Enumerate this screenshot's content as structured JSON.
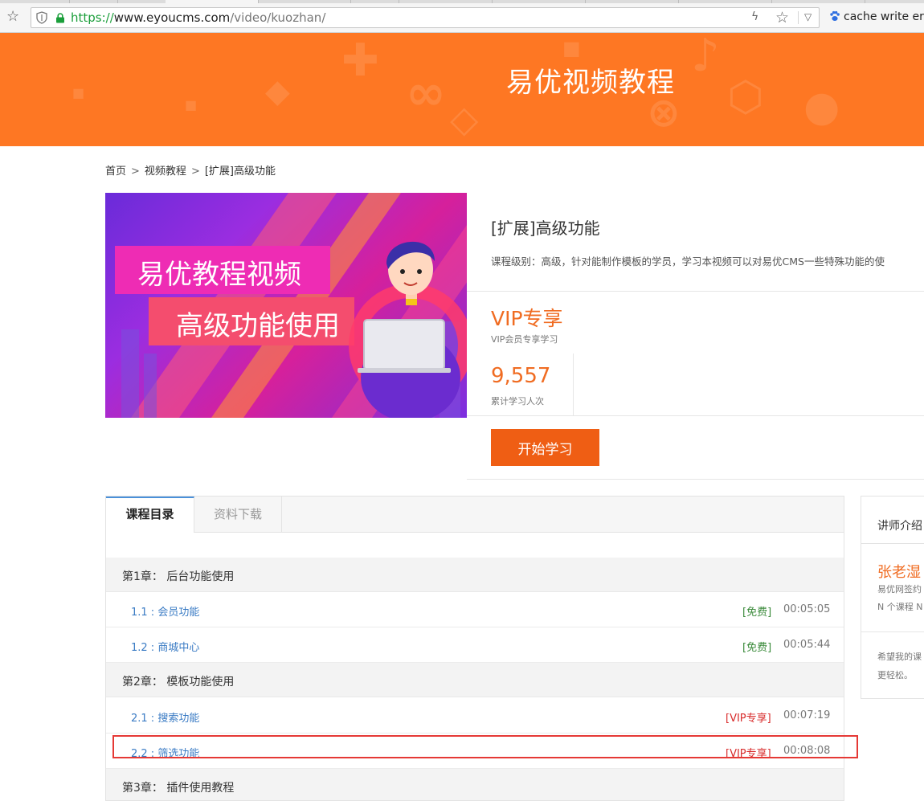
{
  "browser": {
    "url_scheme": "https://",
    "url_host": "www.eyoucms.com",
    "url_path": "/video/kuozhan/",
    "extension_text": "cache write err"
  },
  "banner": {
    "title": "易优视频教程"
  },
  "breadcrumb": {
    "items": [
      "首页",
      "视频教程",
      "[扩展]高级功能"
    ],
    "separator": ">"
  },
  "cover": {
    "line1": "易优教程视频",
    "line2": "高级功能使用"
  },
  "course": {
    "name": "[扩展]高级功能",
    "description": "课程级别：高级，针对能制作模板的学员，学习本视频可以对易优CMS一些特殊功能的使",
    "price": "VIP专享",
    "price_note": "VIP会员专享学习",
    "learners": "9,557",
    "learners_label": "累计学习人次",
    "start_button": "开始学习"
  },
  "tabs": {
    "catalog": "课程目录",
    "downloads": "资料下载"
  },
  "chapters": [
    {
      "title": "第1章：  后台功能使用"
    },
    {
      "title": "第2章：  模板功能使用"
    },
    {
      "title": "第3章：  插件使用教程"
    }
  ],
  "lessons": [
    {
      "title": "1.1 : 会员功能",
      "tag": "[免费]",
      "duration": "00:05:05"
    },
    {
      "title": "1.2 : 商城中心",
      "tag": "[免费]",
      "duration": "00:05:44"
    },
    {
      "title": "2.1 : 搜索功能",
      "tag": "[VIP专享]",
      "duration": "00:07:19"
    },
    {
      "title": "2.2 : 筛选功能",
      "tag": "[VIP专享]",
      "duration": "00:08:08"
    }
  ],
  "teacher": {
    "heading": "讲师介绍",
    "name": "张老湿",
    "line1": "易优网签约",
    "line2": "N 个课程 N",
    "bio1": "希望我的课",
    "bio2": "更轻松。"
  },
  "colors": {
    "banner": "#fe7723",
    "accent_orange": "#f06c22",
    "button": "#ef5e14",
    "link_blue": "#3a7bc4",
    "free_green": "#3a8a3a",
    "vip_red": "#d82b2b",
    "highlight_red": "#e53935"
  }
}
